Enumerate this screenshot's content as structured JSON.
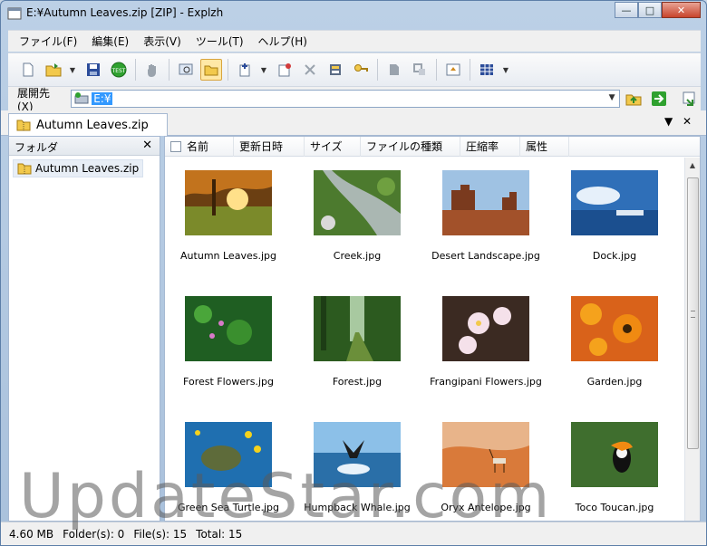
{
  "window": {
    "title": "E:¥Autumn Leaves.zip [ZIP] - Explzh"
  },
  "menu": [
    "ファイル(F)",
    "編集(E)",
    "表示(V)",
    "ツール(T)",
    "ヘルプ(H)"
  ],
  "path": {
    "label": "展開先(X)",
    "value": "E:¥"
  },
  "tab": {
    "label": "Autumn Leaves.zip"
  },
  "folder_pane": {
    "title": "フォルダ",
    "item": "Autumn Leaves.zip"
  },
  "columns": [
    "名前",
    "更新日時",
    "サイズ",
    "ファイルの種類",
    "圧縮率",
    "属性"
  ],
  "files": [
    {
      "name": "Autumn Leaves.jpg",
      "thumb": "autumn"
    },
    {
      "name": "Creek.jpg",
      "thumb": "creek"
    },
    {
      "name": "Desert Landscape.jpg",
      "thumb": "desert"
    },
    {
      "name": "Dock.jpg",
      "thumb": "dock"
    },
    {
      "name": "Forest Flowers.jpg",
      "thumb": "forestflowers"
    },
    {
      "name": "Forest.jpg",
      "thumb": "forest"
    },
    {
      "name": "Frangipani Flowers.jpg",
      "thumb": "frangipani"
    },
    {
      "name": "Garden.jpg",
      "thumb": "garden"
    },
    {
      "name": "Green Sea Turtle.jpg",
      "thumb": "turtle"
    },
    {
      "name": "Humpback Whale.jpg",
      "thumb": "whale"
    },
    {
      "name": "Oryx Antelope.jpg",
      "thumb": "oryx"
    },
    {
      "name": "Toco Toucan.jpg",
      "thumb": "toucan"
    }
  ],
  "status": {
    "size": "4.60 MB",
    "folders": "Folder(s): 0",
    "files": "File(s): 15",
    "total": "Total: 15"
  },
  "watermark": "UpdateStar.com",
  "colors": {
    "selection": "#3399ff",
    "accent": "#a6b9d2"
  }
}
